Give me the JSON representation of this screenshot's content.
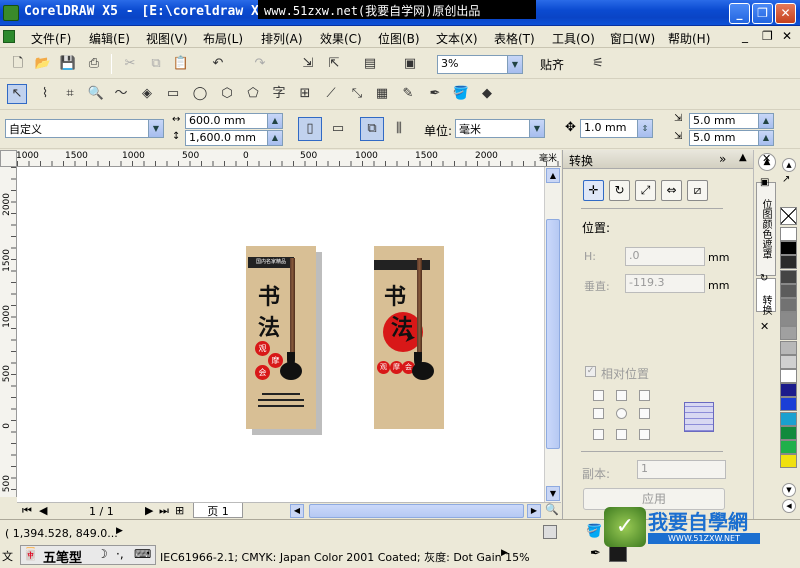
{
  "window": {
    "title": "CorelDRAW X5 - [E:\\coreldraw X",
    "watermark": "www.51zxw.net(我要自学网)原创出品",
    "min": "_",
    "max": "❐",
    "close": "✕"
  },
  "menu": [
    "文件(F)",
    "编辑(E)",
    "视图(V)",
    "布局(L)",
    "排列(A)",
    "效果(C)",
    "位图(B)",
    "文本(X)",
    "表格(T)",
    "工具(O)",
    "窗口(W)",
    "帮助(H)"
  ],
  "menu_doc_controls": {
    "min": "_",
    "restore": "❐",
    "close": "✕"
  },
  "standard_toolbar": {
    "zoom_value": "3%",
    "snap_label": "贴齐"
  },
  "property_bar": {
    "page_preset": "自定义",
    "width": "600.0 mm",
    "height": "1,600.0 mm",
    "units_label": "单位:",
    "units_value": "毫米",
    "nudge": "1.0 mm",
    "dup_x": "5.0 mm",
    "dup_y": "5.0 mm"
  },
  "ruler": {
    "h_labels": [
      "1000",
      "1500",
      "1000",
      "500",
      "0",
      "500",
      "1000",
      "1500",
      "2000"
    ],
    "h_unit": "毫米",
    "v_labels": [
      "2000",
      "1500",
      "1000",
      "500",
      "0",
      "500"
    ]
  },
  "cards": {
    "left_tag": "国内名家精品",
    "title_top": "书",
    "title_bottom": "法",
    "left_badges": [
      "观",
      "摩",
      "会"
    ],
    "right_badges": [
      "观",
      "摩",
      "会"
    ]
  },
  "page_nav": {
    "counter": "1 / 1",
    "page_tab": "页 1"
  },
  "docker": {
    "title": "转换",
    "position_label": "位置:",
    "h_label": "H:",
    "h_value": ".0",
    "v_label": "垂直:",
    "v_value": "-119.3",
    "unit": "mm",
    "relative_label": "相对位置",
    "copies_label": "副本:",
    "copies_value": "1",
    "apply_label": "应用",
    "side_tab_1": "位图颜色遮罩",
    "side_tab_2": "转换"
  },
  "status": {
    "coords": "( 1,394.528, 849.0...",
    "doc_label": "文",
    "ime_label": "五笔型",
    "color_profile": "IEC61966-2.1; CMYK: Japan Color 2001 Coated; 灰度: Dot Gain 15%",
    "logo_text": "我要自學網",
    "logo_url": "WWW.51ZXW.NET"
  },
  "palette_colors": [
    "#ffffff",
    "#000000",
    "#2a2a2a",
    "#444444",
    "#5c5c5c",
    "#727272",
    "#8a8a8a",
    "#a0a0a0",
    "#b8b8b8",
    "#d0d0d0",
    "#ffffff",
    "#1c1c8c",
    "#1a3fd6",
    "#1aa0d0",
    "#118a3c",
    "#1fb04a",
    "#f0e010"
  ],
  "colors": {
    "accent": "#0a44c6",
    "card": "#d8bf95",
    "seal_red": "#d81818"
  }
}
